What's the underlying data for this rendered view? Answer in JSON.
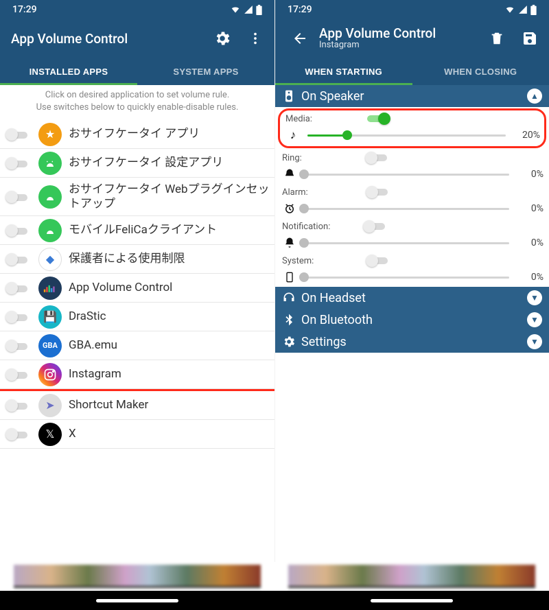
{
  "status": {
    "time": "17:29"
  },
  "left": {
    "title": "App Volume Control",
    "tabs": {
      "installed": "INSTALLED APPS",
      "system": "SYSTEM APPS"
    },
    "hint_line1": "Click on desired application to set volume rule.",
    "hint_line2": "Use switches below to quickly enable-disable rules.",
    "apps": [
      {
        "name": "おサイフケータイ アプリ"
      },
      {
        "name": "おサイフケータイ 設定アプリ"
      },
      {
        "name": "おサイフケータイ Webプラグインセットアップ"
      },
      {
        "name": "モバイルFeliCaクライアント"
      },
      {
        "name": "保護者による使用制限"
      },
      {
        "name": "App Volume Control"
      },
      {
        "name": "DraStic"
      },
      {
        "name": "GBA.emu"
      },
      {
        "name": "Instagram"
      },
      {
        "name": "Shortcut Maker"
      },
      {
        "name": "X"
      }
    ]
  },
  "right": {
    "title": "App Volume Control",
    "subtitle": "Instagram",
    "tabs": {
      "start": "WHEN STARTING",
      "close": "WHEN CLOSING"
    },
    "sections": {
      "speaker": "On Speaker",
      "headset": "On Headset",
      "bluetooth": "On Bluetooth",
      "settings": "Settings"
    },
    "channels": {
      "media": {
        "label": "Media:",
        "enabled": true,
        "percent": 20,
        "percent_label": "20%"
      },
      "ring": {
        "label": "Ring:",
        "enabled": false,
        "percent": 0,
        "percent_label": "0%"
      },
      "alarm": {
        "label": "Alarm:",
        "enabled": false,
        "percent": 0,
        "percent_label": "0%"
      },
      "notification": {
        "label": "Notification:",
        "enabled": false,
        "percent": 0,
        "percent_label": "0%"
      },
      "system": {
        "label": "System:",
        "enabled": false,
        "percent": 0,
        "percent_label": "0%"
      }
    }
  }
}
